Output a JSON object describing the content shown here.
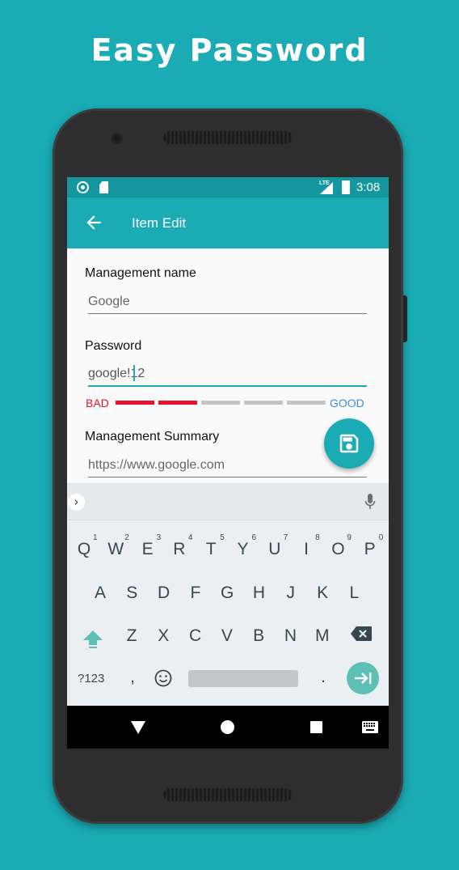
{
  "hero": {
    "title": "Easy Password"
  },
  "statusbar": {
    "network": "LTE",
    "time": "3:08"
  },
  "appbar": {
    "title": "Item Edit"
  },
  "form": {
    "management_name": {
      "label": "Management name",
      "value": "Google"
    },
    "password": {
      "label": "Password",
      "value": "google!12"
    },
    "strength": {
      "bad_label": "BAD",
      "good_label": "GOOD",
      "level": 0.4,
      "segments": 5,
      "bad_color": "#e8112d",
      "good_color": "#3d8fd1",
      "inactive_color": "#c4c4c4"
    },
    "summary": {
      "label": "Management Summary",
      "value": "https://www.google.com"
    }
  },
  "fab": {
    "icon": "floppy-disk-icon"
  },
  "keyboard": {
    "row1": [
      {
        "key": "Q",
        "hint": "1"
      },
      {
        "key": "W",
        "hint": "2"
      },
      {
        "key": "E",
        "hint": "3"
      },
      {
        "key": "R",
        "hint": "4"
      },
      {
        "key": "T",
        "hint": "5"
      },
      {
        "key": "Y",
        "hint": "6"
      },
      {
        "key": "U",
        "hint": "7"
      },
      {
        "key": "I",
        "hint": "8"
      },
      {
        "key": "O",
        "hint": "9"
      },
      {
        "key": "P",
        "hint": "0"
      }
    ],
    "row2": [
      "A",
      "S",
      "D",
      "F",
      "G",
      "H",
      "J",
      "K",
      "L"
    ],
    "row3": [
      "Z",
      "X",
      "C",
      "V",
      "B",
      "N",
      "M"
    ],
    "symbols_label": "?123",
    "comma_label": ",",
    "period_label": "."
  },
  "colors": {
    "brand": "#1aabb4",
    "statusbar": "#14979f",
    "background": "#1aabb4"
  }
}
